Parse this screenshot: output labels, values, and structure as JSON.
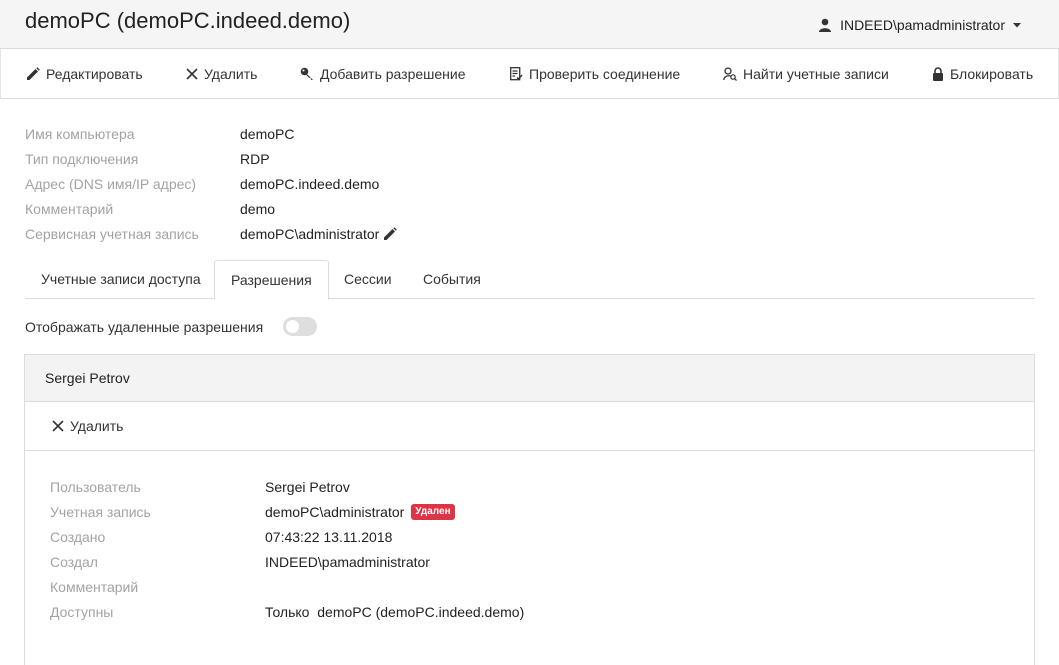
{
  "header": {
    "title": "demoPC (demoPC.indeed.demo)",
    "user": "INDEED\\pamadministrator"
  },
  "toolbar": {
    "edit": "Редактировать",
    "delete": "Удалить",
    "add_permission": "Добавить разрешение",
    "check_connection": "Проверить соединение",
    "find_accounts": "Найти учетные записи",
    "block": "Блокировать"
  },
  "properties": [
    {
      "label": "Имя компьютера",
      "value": "demoPC"
    },
    {
      "label": "Тип подключения",
      "value": "RDP"
    },
    {
      "label": "Адрес (DNS имя/IP адрес)",
      "value": "demoPC.indeed.demo"
    },
    {
      "label": "Комментарий",
      "value": "demo"
    },
    {
      "label": "Сервисная учетная запись",
      "value": "demoPC\\administrator"
    }
  ],
  "tabs": [
    {
      "label": "Учетные записи доступа",
      "active": false
    },
    {
      "label": "Разрешения",
      "active": true
    },
    {
      "label": "Сессии",
      "active": false
    },
    {
      "label": "События",
      "active": false
    }
  ],
  "show_deleted": {
    "label": "Отображать удаленные разрешения",
    "checked": false
  },
  "permission": {
    "title": "Sergei Petrov",
    "delete": "Удалить",
    "fields": [
      {
        "label": "Пользователь",
        "value": "Sergei Petrov"
      },
      {
        "label": "Учетная запись",
        "value": "demoPC\\administrator",
        "badge": "Удален"
      },
      {
        "label": "Создано",
        "value": "07:43:22 13.11.2018"
      },
      {
        "label": "Создал",
        "value": "INDEED\\pamadministrator"
      },
      {
        "label": "Комментарий",
        "value": ""
      },
      {
        "label": "Доступны",
        "value": "Только  demoPC (demoPC.indeed.demo)"
      }
    ]
  },
  "colors": {
    "badge": "#dc3545",
    "label": "#a3a3a3",
    "header_bg": "#f5f5f5"
  }
}
